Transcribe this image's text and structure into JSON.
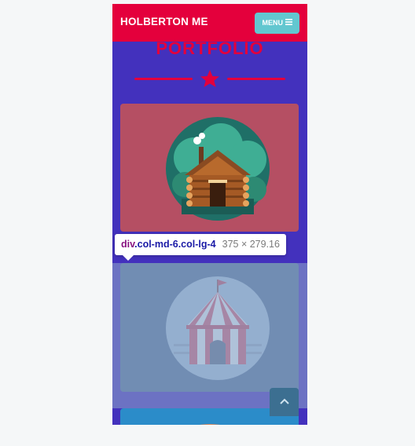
{
  "navbar": {
    "brand": "HOLBERTON ME",
    "menu_label": "MENU",
    "menu_icon": "hamburger-icon"
  },
  "section": {
    "title": "PORTFOLIO",
    "divider_icon": "star-icon"
  },
  "portfolio": {
    "items": [
      {
        "illustration": "log-cabin-icon",
        "bg": "#b54f63"
      },
      {
        "illustration": "circus-tent-icon",
        "bg": "#4f6d9a"
      },
      {
        "illustration": "partial-item",
        "bg": "#2b8cc9"
      }
    ]
  },
  "devtools_tooltip": {
    "tag": "div",
    "classes": ".col-md-6.col-lg-4",
    "size": "375 × 279.16"
  },
  "scroll_top": {
    "icon": "chevron-up-icon"
  },
  "colors": {
    "brand_red": "#e4003c",
    "page_bg": "#4331bd",
    "menu_button": "#62c7d0"
  }
}
